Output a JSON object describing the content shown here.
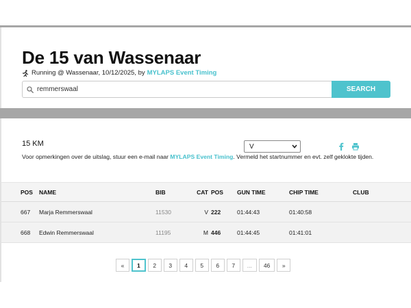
{
  "header": {
    "title": "De 15 van Wassenaar",
    "subtitle_text": "Running @ Wassenaar, 10/12/2025, by",
    "organizer": "MYLAPS Event Timing",
    "icons": {
      "sport": "running-icon",
      "search": "search-icon"
    }
  },
  "search": {
    "value": "remmerswaal",
    "placeholder": "",
    "button_label": "SEARCH"
  },
  "results": {
    "distance": "15 KM",
    "category_filter": {
      "selected": "V"
    },
    "share_icons": [
      "facebook-icon",
      "print-icon"
    ],
    "notice_before": "Voor opmerkingen over de uitslag, stuur een e-mail naar",
    "notice_link": "MYLAPS Event Timing",
    "notice_after": ". Vermeld het startnummer en evt. zelf geklokte tijden."
  },
  "table": {
    "columns": {
      "pos": "POS",
      "name": "NAME",
      "bib": "BIB",
      "cat": "CAT",
      "catpos": "POS",
      "gun": "GUN TIME",
      "chip": "CHIP TIME",
      "club": "CLUB"
    },
    "rows": [
      {
        "pos": "667",
        "name": "Marja Remmerswaal",
        "bib": "11530",
        "cat": "V",
        "catpos": "222",
        "gun": "01:44:43",
        "chip": "01:40:58",
        "club": ""
      },
      {
        "pos": "668",
        "name": "Edwin Remmerswaal",
        "bib": "11195",
        "cat": "M",
        "catpos": "446",
        "gun": "01:44:45",
        "chip": "01:41:01",
        "club": ""
      }
    ]
  },
  "pagination": {
    "prev": "«",
    "pages": [
      "1",
      "2",
      "3",
      "4",
      "5",
      "6",
      "7",
      "...",
      "46"
    ],
    "next": "»",
    "current": "1"
  },
  "colors": {
    "accent": "#4ec3cd",
    "band": "#a6a6a6"
  }
}
